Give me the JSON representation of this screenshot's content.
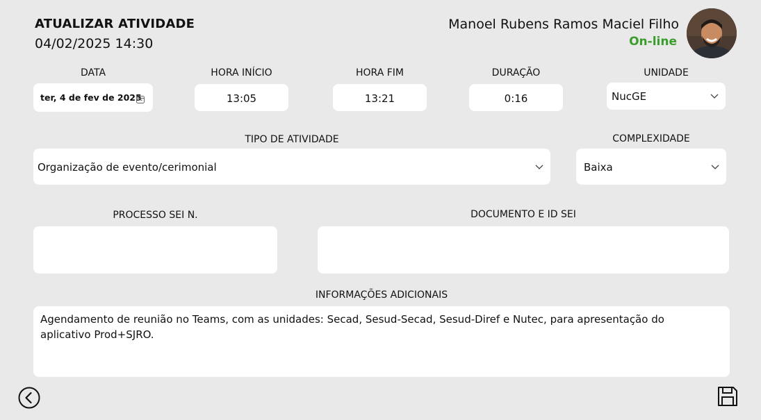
{
  "header": {
    "title": "ATUALIZAR ATIVIDADE",
    "datetime": "04/02/2025 14:30",
    "user_name": "Manoel Rubens Ramos Maciel Filho",
    "status": "On-line",
    "status_color": "#3a9d2c"
  },
  "fields": {
    "data": {
      "label": "DATA",
      "value": "ter, 4 de fev de 2025"
    },
    "hora_inicio": {
      "label": "HORA INÍCIO",
      "value": "13:05"
    },
    "hora_fim": {
      "label": "HORA FIM",
      "value": "13:21"
    },
    "duracao": {
      "label": "DURAÇÃO",
      "value": "0:16"
    },
    "unidade": {
      "label": "UNIDADE",
      "value": "NucGE"
    },
    "tipo_atividade": {
      "label": "TIPO DE ATIVIDADE",
      "value": "Organização de evento/cerimonial"
    },
    "complexidade": {
      "label": "COMPLEXIDADE",
      "value": "Baixa"
    },
    "processo_sei": {
      "label": "PROCESSO SEI N.",
      "value": ""
    },
    "documento_id_sei": {
      "label": "DOCUMENTO E ID SEI",
      "value": ""
    },
    "informacoes": {
      "label": "INFORMAÇÕES ADICIONAIS",
      "value": "Agendamento de reunião no Teams, com as unidades: Secad, Sesud-Secad, Sesud-Diref e Nutec, para apresentação do aplicativo Prod+SJRO."
    }
  },
  "icons": {
    "back": "back-arrow-icon",
    "save": "save-icon",
    "calendar": "calendar-icon",
    "dropdown": "chevron-down-icon"
  }
}
